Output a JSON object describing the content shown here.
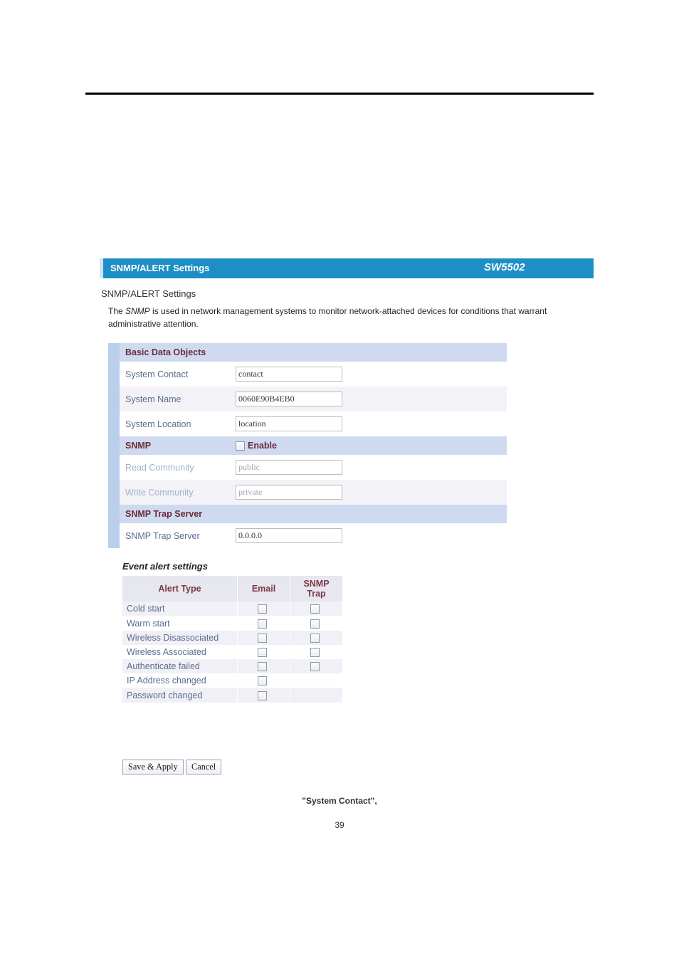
{
  "title_bar": {
    "title": "SNMP/ALERT Settings",
    "model": "SW5502"
  },
  "section_title": "SNMP/ALERT Settings",
  "description": {
    "pre": "The ",
    "snmp_i": "SNMP",
    "post": " is used in network management systems to monitor network-attached devices for conditions that warrant administrative attention."
  },
  "basic": {
    "header": "Basic Data Objects",
    "rows": [
      {
        "label": "System Contact",
        "value": "contact"
      },
      {
        "label": "System Name",
        "value": "0060E90B4EB0"
      },
      {
        "label": "System Location",
        "value": "location"
      }
    ]
  },
  "snmp": {
    "header": "SNMP",
    "enable_label": "Enable",
    "rows": [
      {
        "label": "Read Community",
        "value": "public"
      },
      {
        "label": "Write Community",
        "value": "private"
      }
    ]
  },
  "trap": {
    "header": "SNMP Trap Server",
    "label": "SNMP Trap Server",
    "value": "0.0.0.0"
  },
  "events": {
    "header": "Event alert settings",
    "cols": {
      "c1": "Alert Type",
      "c2": "Email",
      "c3": "SNMP Trap"
    },
    "rows": [
      {
        "label": "Cold start",
        "email": true,
        "trap": true
      },
      {
        "label": "Warm start",
        "email": true,
        "trap": true
      },
      {
        "label": "Wireless Disassociated",
        "email": true,
        "trap": true
      },
      {
        "label": "Wireless Associated",
        "email": true,
        "trap": true
      },
      {
        "label": "Authenticate failed",
        "email": true,
        "trap": true
      },
      {
        "label": "IP Address changed",
        "email": true,
        "trap": false
      },
      {
        "label": "Password changed",
        "email": true,
        "trap": false
      }
    ]
  },
  "buttons": {
    "save": "Save & Apply",
    "cancel": "Cancel"
  },
  "footer_bold": "\"System Contact\",",
  "page_number": "39"
}
